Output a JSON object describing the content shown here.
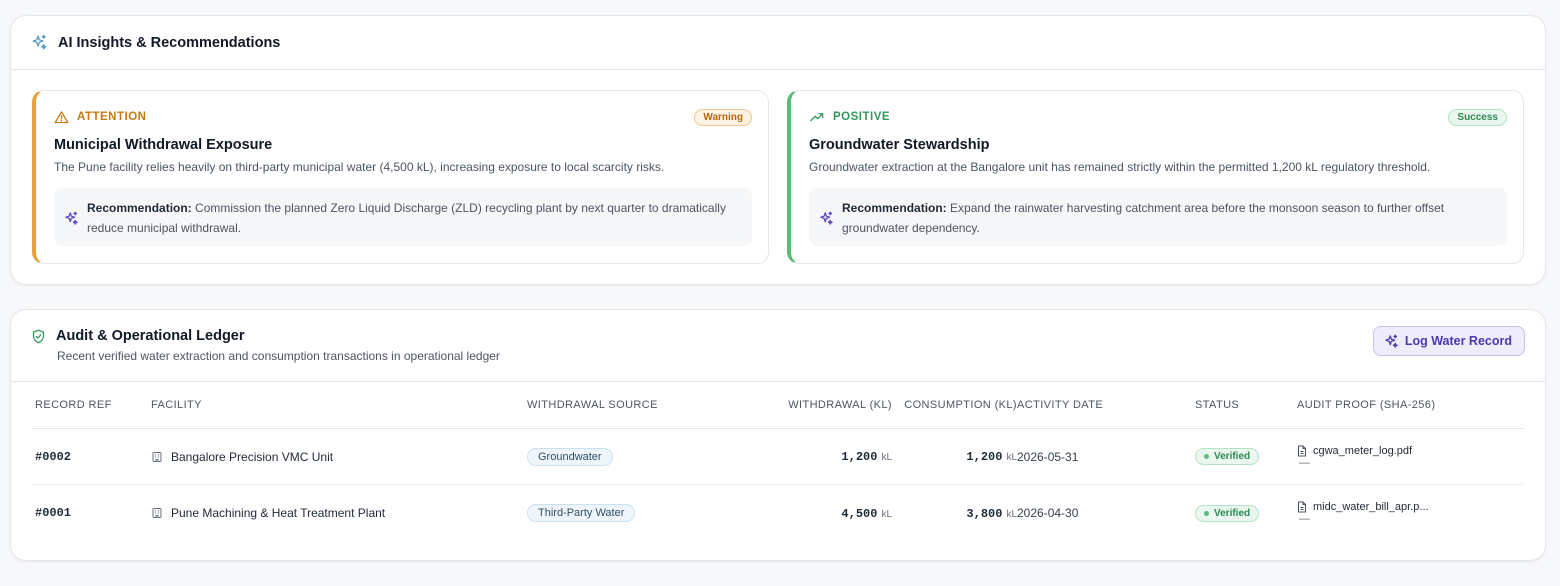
{
  "insights": {
    "title": "AI Insights & Recommendations",
    "items": [
      {
        "kind": "ATTENTION",
        "badge": "Warning",
        "title": "Municipal Withdrawal Exposure",
        "description": "The Pune facility relies heavily on third-party municipal water (4,500 kL), increasing exposure to local scarcity risks.",
        "recommendation_label": "Recommendation:",
        "recommendation_text": "Commission the planned Zero Liquid Discharge (ZLD) recycling plant by next quarter to dramatically reduce municipal withdrawal."
      },
      {
        "kind": "POSITIVE",
        "badge": "Success",
        "title": "Groundwater Stewardship",
        "description": "Groundwater extraction at the Bangalore unit has remained strictly within the permitted 1,200 kL regulatory threshold.",
        "recommendation_label": "Recommendation:",
        "recommendation_text": "Expand the rainwater harvesting catchment area before the monsoon season to further offset groundwater dependency."
      }
    ]
  },
  "ledger": {
    "title": "Audit & Operational Ledger",
    "subtitle": "Recent verified water extraction and consumption transactions in operational ledger",
    "log_button": "Log Water Record",
    "columns": [
      "RECORD REF",
      "FACILITY",
      "WITHDRAWAL SOURCE",
      "WITHDRAWAL (KL)",
      "CONSUMPTION (KL)",
      "ACTIVITY DATE",
      "STATUS",
      "AUDIT PROOF (SHA-256)"
    ],
    "rows": [
      {
        "ref": "#0002",
        "facility": "Bangalore Precision VMC Unit",
        "source": "Groundwater",
        "withdrawal": "1,200",
        "withdrawal_unit": "kL",
        "consumption": "1,200",
        "consumption_unit": "kL",
        "date": "2026-05-31",
        "status": "Verified",
        "proof_file": "cgwa_meter_log.pdf",
        "proof_hash": "—"
      },
      {
        "ref": "#0001",
        "facility": "Pune Machining & Heat Treatment Plant",
        "source": "Third-Party Water",
        "withdrawal": "4,500",
        "withdrawal_unit": "kL",
        "consumption": "3,800",
        "consumption_unit": "kL",
        "date": "2026-04-30",
        "status": "Verified",
        "proof_file": "midc_water_bill_apr.p...",
        "proof_hash": "—"
      }
    ]
  },
  "colors": {
    "warning_accent": "#e9a23b",
    "success_accent": "#5dbb7d",
    "brand_purple": "#4b3ab0"
  },
  "icons": {
    "insights_header": "sparkles-icon",
    "attention": "alert-triangle-icon",
    "positive": "trending-up-icon",
    "recommendation": "sparkles-icon",
    "ledger_header": "shield-check-icon",
    "facility": "building-icon",
    "proof": "file-icon"
  }
}
